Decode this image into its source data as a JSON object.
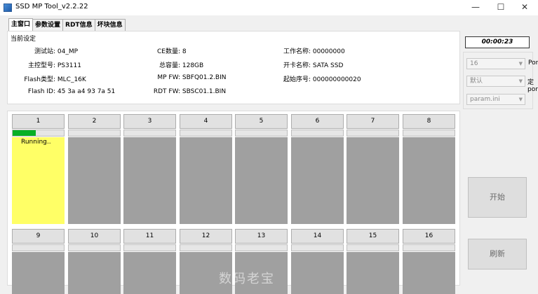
{
  "window": {
    "title": "SSD MP Tool_v2.2.22",
    "min": "—",
    "max": "☐",
    "close": "✕"
  },
  "tabs": [
    "主窗口",
    "参数设置",
    "RDT信息",
    "坏块信息"
  ],
  "settings": {
    "group_title": "当前设定",
    "station": {
      "label": "测试站:",
      "value": "04_MP"
    },
    "controller": {
      "label": "主控型号:",
      "value": "PS3111"
    },
    "flash_type": {
      "label": "Flash类型:",
      "value": "MLC_16K"
    },
    "flash_id": {
      "label": "Flash ID:",
      "value": "45 3a a4 93 7a 51"
    },
    "ce_count": {
      "label": "CE数量:",
      "value": "8"
    },
    "capacity": {
      "label": "总容量:",
      "value": "128GB"
    },
    "mp_fw": {
      "label": "MP FW:",
      "value": "SBFQ01.2.BIN"
    },
    "rdt_fw": {
      "label": "RDT FW:",
      "value": "SBSC01.1.BIN"
    },
    "work_name": {
      "label": "工作名称:",
      "value": "00000000"
    },
    "card_name": {
      "label": "开卡名称:",
      "value": "SATA SSD"
    },
    "start_serial": {
      "label": "起始序号:",
      "value": "000000000020"
    }
  },
  "timer": "00:00:23",
  "side": {
    "ports_value": "16",
    "ports_label": "Ports",
    "default_value": "默认",
    "default_label": "定port",
    "ini_value": "param.ini",
    "start_label": "开始",
    "refresh_label": "刷新"
  },
  "ports": [
    {
      "label": "1",
      "status": "Running..",
      "progress": 0.45,
      "state": "running"
    },
    {
      "label": "2",
      "status": "",
      "progress": 0,
      "state": "idle"
    },
    {
      "label": "3",
      "status": "",
      "progress": 0,
      "state": "idle"
    },
    {
      "label": "4",
      "status": "",
      "progress": 0,
      "state": "idle"
    },
    {
      "label": "5",
      "status": "",
      "progress": 0,
      "state": "idle"
    },
    {
      "label": "6",
      "status": "",
      "progress": 0,
      "state": "idle"
    },
    {
      "label": "7",
      "status": "",
      "progress": 0,
      "state": "idle"
    },
    {
      "label": "8",
      "status": "",
      "progress": 0,
      "state": "idle"
    },
    {
      "label": "9",
      "status": "",
      "progress": 0,
      "state": "idle"
    },
    {
      "label": "10",
      "status": "",
      "progress": 0,
      "state": "idle"
    },
    {
      "label": "11",
      "status": "",
      "progress": 0,
      "state": "idle"
    },
    {
      "label": "12",
      "status": "",
      "progress": 0,
      "state": "idle"
    },
    {
      "label": "13",
      "status": "",
      "progress": 0,
      "state": "idle"
    },
    {
      "label": "14",
      "status": "",
      "progress": 0,
      "state": "idle"
    },
    {
      "label": "15",
      "status": "",
      "progress": 0,
      "state": "idle"
    },
    {
      "label": "16",
      "status": "",
      "progress": 0,
      "state": "idle"
    }
  ],
  "colors": {
    "running": "#ffff66",
    "idle": "#a0a0a0",
    "progress": "#06b025"
  },
  "watermark": "数码老宝"
}
